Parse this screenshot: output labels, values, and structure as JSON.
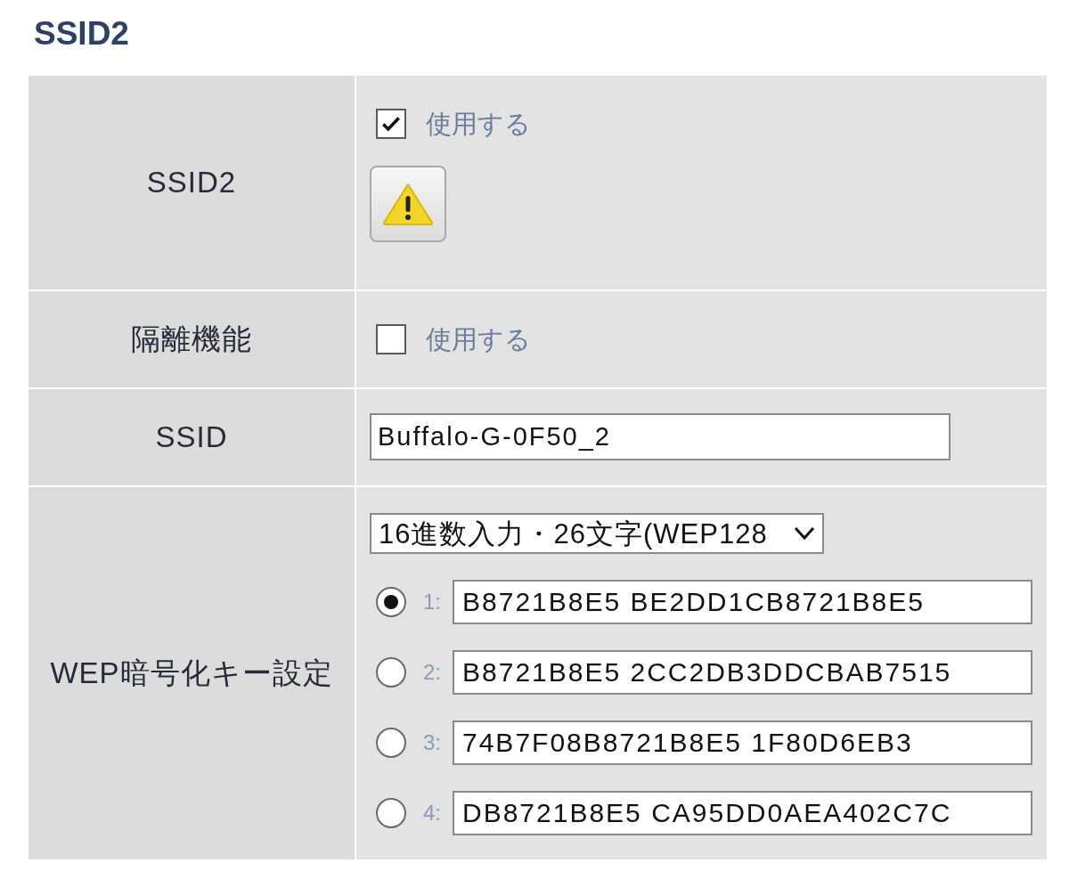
{
  "title": "SSID2",
  "rows": [
    {
      "kind": "toggle",
      "label": "SSID2",
      "option": {
        "label": "使用する",
        "checked": true
      },
      "warning_button": true
    },
    {
      "kind": "toggle",
      "label": "隔離機能",
      "option": {
        "label": "使用する",
        "checked": false
      },
      "warning_button": false
    },
    {
      "kind": "text",
      "label": "SSID",
      "value": "Buffalo-G-0F50_2"
    },
    {
      "kind": "wep",
      "label": "WEP暗号化キー設定",
      "select": {
        "value": "16進数入力・26文字(WEP128"
      },
      "keys": [
        {
          "number": "1:",
          "value": "B8721B8E5 BE2DD1CB8721B8E5",
          "selected": true
        },
        {
          "number": "2:",
          "value": "B8721B8E5 2CC2DB3DDCBAB7515",
          "selected": false
        },
        {
          "number": "3:",
          "value": "74B7F08B8721B8E5 1F80D6EB3",
          "selected": false
        },
        {
          "number": "4:",
          "value": "DB8721B8E5 CA95DD0AEA402C7C",
          "selected": false
        }
      ]
    }
  ]
}
